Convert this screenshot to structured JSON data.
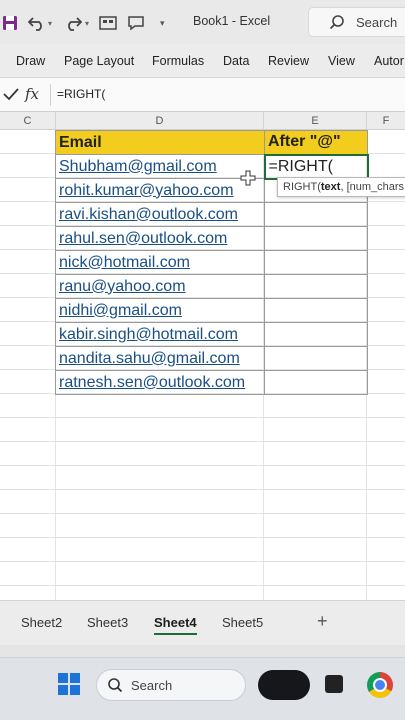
{
  "window": {
    "title": "Book1 - Excel"
  },
  "title_search": {
    "label": "Search"
  },
  "ribbon": {
    "tabs": [
      "Draw",
      "Page Layout",
      "Formulas",
      "Data",
      "Review",
      "View",
      "Autor"
    ]
  },
  "formula_bar": {
    "fx": "fx",
    "content": "=RIGHT("
  },
  "columns": [
    "C",
    "D",
    "E",
    "F"
  ],
  "table": {
    "headers": [
      "Email",
      "After \"@\""
    ],
    "rows": [
      {
        "email": "Shubham@gmail.com",
        "after": "=RIGHT("
      },
      {
        "email": "rohit.kumar@yahoo.com",
        "after": ""
      },
      {
        "email": "ravi.kishan@outlook.com",
        "after": ""
      },
      {
        "email": "rahul.sen@outlook.com",
        "after": ""
      },
      {
        "email": "nick@hotmail.com",
        "after": ""
      },
      {
        "email": "ranu@yahoo.com",
        "after": ""
      },
      {
        "email": "nidhi@gmail.com",
        "after": ""
      },
      {
        "email": "kabir.singh@hotmail.com",
        "after": ""
      },
      {
        "email": "nandita.sahu@gmail.com",
        "after": ""
      },
      {
        "email": "ratnesh.sen@outlook.com",
        "after": ""
      }
    ]
  },
  "tooltip": {
    "fn": "RIGHT(",
    "arg1": "text",
    "rest": ", [num_chars"
  },
  "sheets": {
    "tabs": [
      "Sheet2",
      "Sheet3",
      "Sheet4",
      "Sheet5"
    ],
    "active": "Sheet4",
    "add": "+"
  },
  "taskbar": {
    "search_label": "Search"
  },
  "colors": {
    "header_fill": "#f2cd1e",
    "link": "#1a4f86",
    "active_border": "#1f6b3a",
    "excel_green": "#1f6b3a"
  }
}
